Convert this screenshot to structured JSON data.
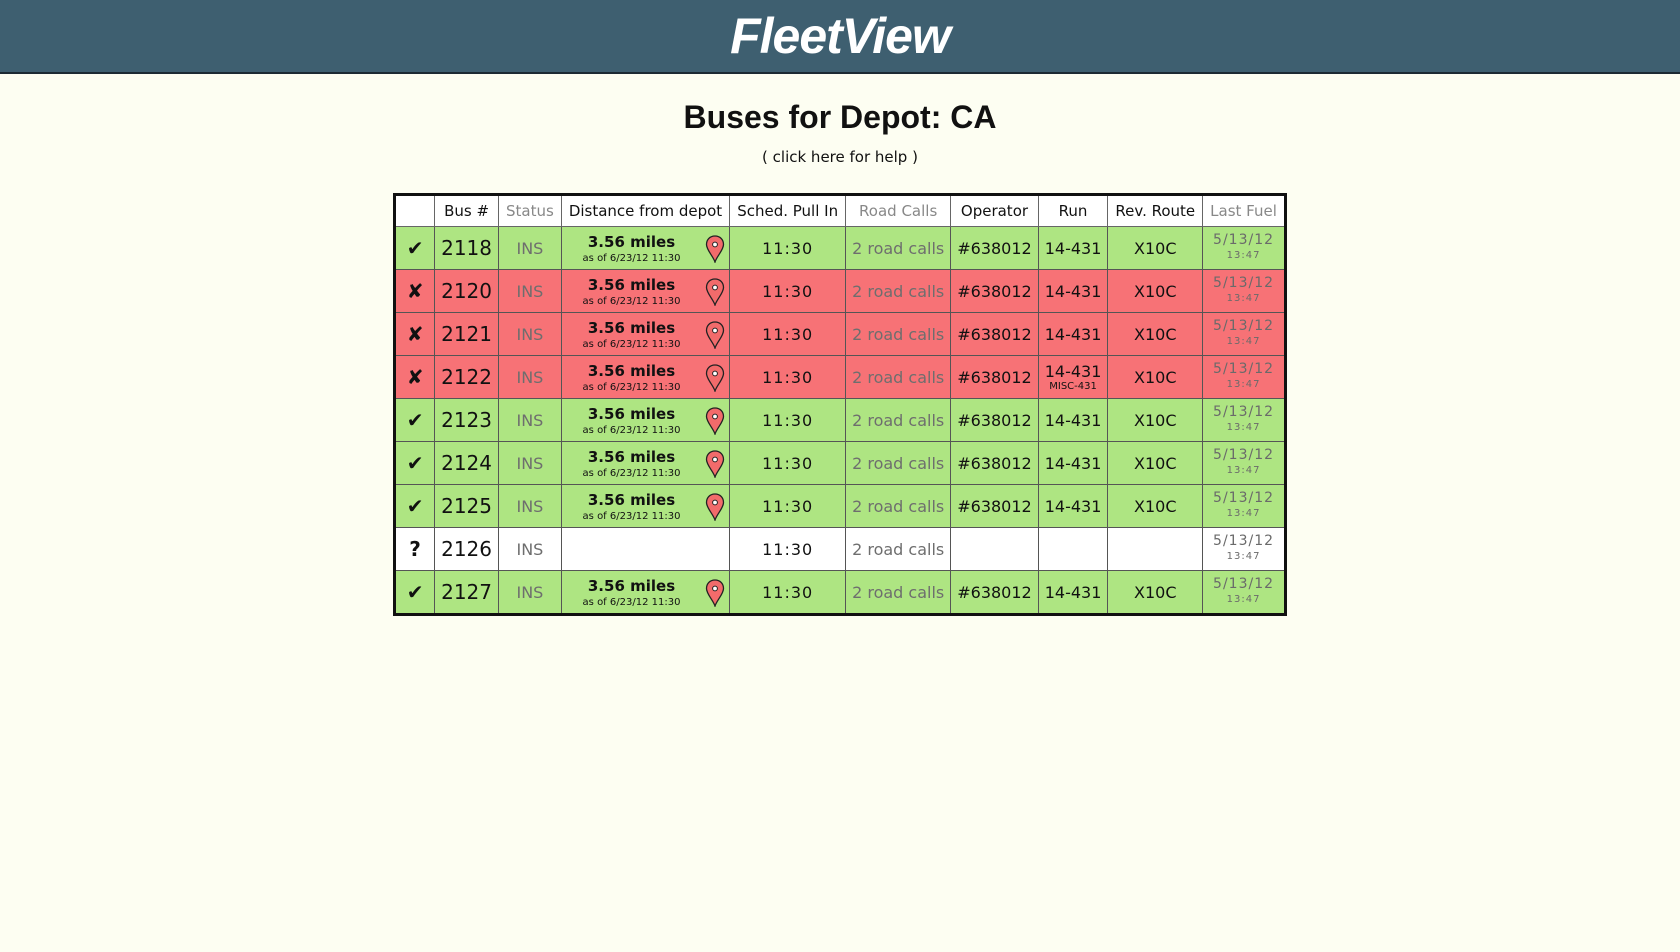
{
  "app": {
    "title": "FleetView"
  },
  "page": {
    "title": "Buses for Depot: CA",
    "help_link": "( click here for help )"
  },
  "table": {
    "headers": [
      "",
      "Bus #",
      "Status",
      "Distance from depot",
      "Sched. Pull In",
      "Road Calls",
      "Operator",
      "Run",
      "Rev. Route",
      "Last Fuel"
    ],
    "colors": {
      "ok": "#aee582",
      "fail": "#f77276",
      "unknown": "#ffffff"
    },
    "rows": [
      {
        "mark": "✔",
        "state": "green",
        "bus": "2118",
        "status": "INS",
        "distance": "3.56 miles",
        "as_of": "as of 6/23/12 11:30",
        "sched": "11:30",
        "road_calls": "2 road calls",
        "operator": "#638012",
        "run": "14-431",
        "run_sub": "",
        "route": "X10C",
        "fuel_date": "5/13/12",
        "fuel_time": "13:47"
      },
      {
        "mark": "✘",
        "state": "red",
        "bus": "2120",
        "status": "INS",
        "distance": "3.56 miles",
        "as_of": "as of 6/23/12 11:30",
        "sched": "11:30",
        "road_calls": "2 road calls",
        "operator": "#638012",
        "run": "14-431",
        "run_sub": "",
        "route": "X10C",
        "fuel_date": "5/13/12",
        "fuel_time": "13:47"
      },
      {
        "mark": "✘",
        "state": "red",
        "bus": "2121",
        "status": "INS",
        "distance": "3.56 miles",
        "as_of": "as of 6/23/12 11:30",
        "sched": "11:30",
        "road_calls": "2 road calls",
        "operator": "#638012",
        "run": "14-431",
        "run_sub": "",
        "route": "X10C",
        "fuel_date": "5/13/12",
        "fuel_time": "13:47"
      },
      {
        "mark": "✘",
        "state": "red",
        "bus": "2122",
        "status": "INS",
        "distance": "3.56 miles",
        "as_of": "as of 6/23/12 11:30",
        "sched": "11:30",
        "road_calls": "2 road calls",
        "operator": "#638012",
        "run": "14-431",
        "run_sub": "MISC-431",
        "route": "X10C",
        "fuel_date": "5/13/12",
        "fuel_time": "13:47"
      },
      {
        "mark": "✔",
        "state": "green",
        "bus": "2123",
        "status": "INS",
        "distance": "3.56 miles",
        "as_of": "as of 6/23/12 11:30",
        "sched": "11:30",
        "road_calls": "2 road calls",
        "operator": "#638012",
        "run": "14-431",
        "run_sub": "",
        "route": "X10C",
        "fuel_date": "5/13/12",
        "fuel_time": "13:47"
      },
      {
        "mark": "✔",
        "state": "green",
        "bus": "2124",
        "status": "INS",
        "distance": "3.56 miles",
        "as_of": "as of 6/23/12 11:30",
        "sched": "11:30",
        "road_calls": "2 road calls",
        "operator": "#638012",
        "run": "14-431",
        "run_sub": "",
        "route": "X10C",
        "fuel_date": "5/13/12",
        "fuel_time": "13:47"
      },
      {
        "mark": "✔",
        "state": "green",
        "bus": "2125",
        "status": "INS",
        "distance": "3.56 miles",
        "as_of": "as of 6/23/12 11:30",
        "sched": "11:30",
        "road_calls": "2 road calls",
        "operator": "#638012",
        "run": "14-431",
        "run_sub": "",
        "route": "X10C",
        "fuel_date": "5/13/12",
        "fuel_time": "13:47"
      },
      {
        "mark": "?",
        "state": "white",
        "bus": "2126",
        "status": "INS",
        "distance": "",
        "as_of": "",
        "sched": "11:30",
        "road_calls": "2 road calls",
        "operator": "",
        "run": "",
        "run_sub": "",
        "route": "",
        "fuel_date": "5/13/12",
        "fuel_time": "13:47"
      },
      {
        "mark": "✔",
        "state": "green",
        "bus": "2127",
        "status": "INS",
        "distance": "3.56 miles",
        "as_of": "as of 6/23/12 11:30",
        "sched": "11:30",
        "road_calls": "2 road calls",
        "operator": "#638012",
        "run": "14-431",
        "run_sub": "",
        "route": "X10C",
        "fuel_date": "5/13/12",
        "fuel_time": "13:47"
      }
    ],
    "icons": {
      "location": "map-pin-icon"
    }
  }
}
